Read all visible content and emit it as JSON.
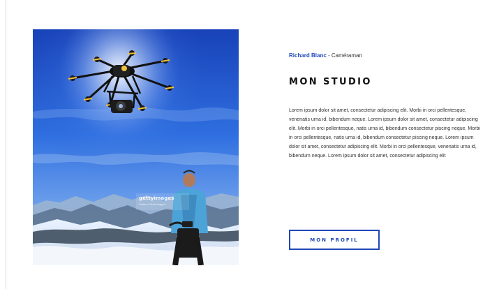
{
  "hero": {
    "watermark_brand": "gettyimages",
    "watermark_sub": "Stefano Vitali Images"
  },
  "header": {
    "author": "Richard Blanc",
    "separator": " - ",
    "role": "Caméraman"
  },
  "main": {
    "title": "MON STUDIO",
    "body": "Lorem ipsum dolor sit amet, consectetur adipiscing elit. Morbi in orci pellentesque, venenatis urna id, bibendum neque. Lorem ipsum dolor sit amet, consectetur adipiscing elit. Morbi in orci pellentesque, natis urna id, bibendum consectetur piscing neque. Morbi in orci pellentesque, natis urna id, bibendum consectetur piscing neque. Lorem ipsum dolor sit amet, consectetur adipiscing elit. Morbi in orci pellentesque, venenatis urna id, bibendum neque. Lorem ipsum dolor sit amet, consectetur adipiscing elit",
    "button_label": "MON PROFIL"
  },
  "colors": {
    "accent": "#2148b8",
    "text": "#333333",
    "heading": "#111111"
  }
}
